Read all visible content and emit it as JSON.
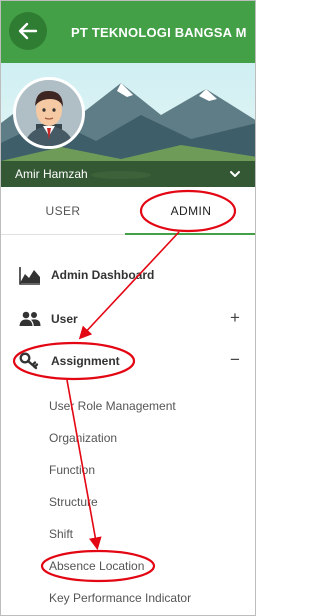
{
  "header": {
    "title": "PT TEKNOLOGI BANGSA M",
    "back_icon": "arrow-left-icon",
    "color": "#43a047"
  },
  "profile": {
    "user_name": "Amir Hamzah",
    "dropdown_icon": "chevron-down-icon"
  },
  "tabs": [
    {
      "label": "USER",
      "active": false
    },
    {
      "label": "ADMIN",
      "active": true
    }
  ],
  "menu": {
    "admin_dashboard": {
      "label": "Admin Dashboard",
      "icon": "area-chart-icon"
    },
    "user": {
      "label": "User",
      "icon": "people-icon",
      "toggle": "+"
    },
    "assignment": {
      "label": "Assignment",
      "icon": "key-icon",
      "toggle": "−"
    },
    "assignment_items": [
      "User Role Management",
      "Organization",
      "Function",
      "Structure",
      "Shift",
      "Absence Location",
      "Key Performance Indicator"
    ]
  },
  "annotation_color": "#e30613"
}
